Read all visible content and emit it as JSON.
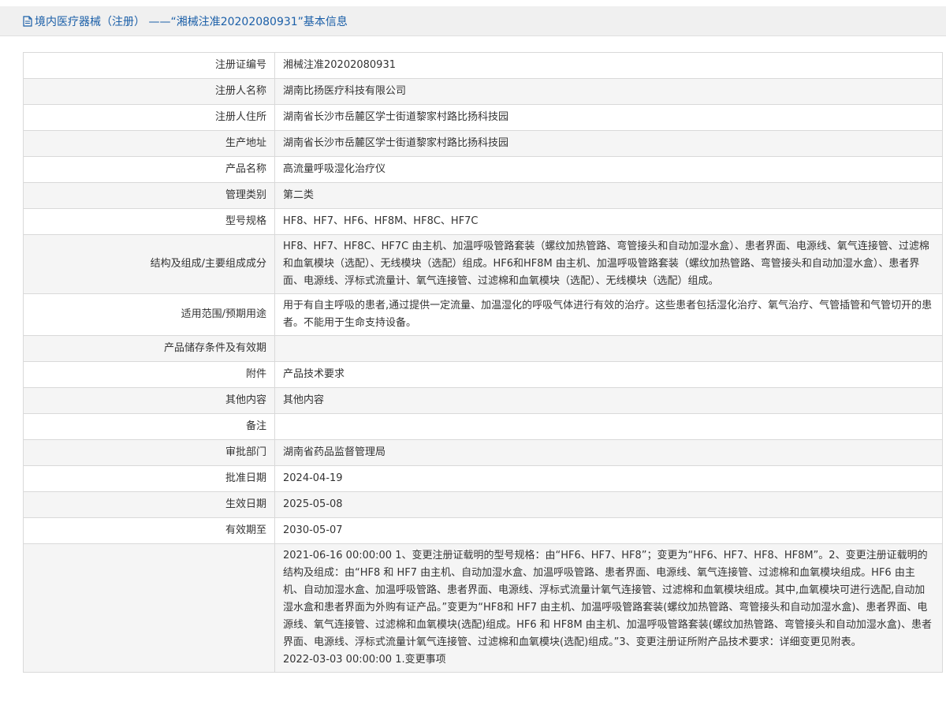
{
  "header": {
    "title": "境内医疗器械（注册） ——“湘械注准20202080931”基本信息"
  },
  "rows": [
    {
      "label": "注册证编号",
      "value": "湘械注准20202080931"
    },
    {
      "label": "注册人名称",
      "value": "湖南比扬医疗科技有限公司"
    },
    {
      "label": "注册人住所",
      "value": "湖南省长沙市岳麓区学士街道黎家村路比扬科技园"
    },
    {
      "label": "生产地址",
      "value": "湖南省长沙市岳麓区学士街道黎家村路比扬科技园"
    },
    {
      "label": "产品名称",
      "value": "高流量呼吸湿化治疗仪"
    },
    {
      "label": "管理类别",
      "value": "第二类"
    },
    {
      "label": "型号规格",
      "value": "HF8、HF7、HF6、HF8M、HF8C、HF7C"
    },
    {
      "label": "结构及组成/主要组成成分",
      "value": "HF8、HF7、HF8C、HF7C 由主机、加温呼吸管路套装（螺纹加热管路、弯管接头和自动加湿水盒）、患者界面、电源线、氧气连接管、过滤棉和血氧模块（选配）、无线模块（选配）组成。HF6和HF8M 由主机、加温呼吸管路套装（螺纹加热管路、弯管接头和自动加湿水盒）、患者界面、电源线、浮标式流量计、氧气连接管、过滤棉和血氧模块（选配）、无线模块（选配）组成。"
    },
    {
      "label": "适用范围/预期用途",
      "value": "用于有自主呼吸的患者,通过提供一定流量、加温湿化的呼吸气体进行有效的治疗。这些患者包括湿化治疗、氧气治疗、气管插管和气管切开的患者。不能用于生命支持设备。"
    },
    {
      "label": "产品储存条件及有效期",
      "value": ""
    },
    {
      "label": "附件",
      "value": "产品技术要求"
    },
    {
      "label": "其他内容",
      "value": "其他内容"
    },
    {
      "label": "备注",
      "value": ""
    },
    {
      "label": "审批部门",
      "value": "湖南省药品监督管理局"
    },
    {
      "label": "批准日期",
      "value": "2024-04-19"
    },
    {
      "label": "生效日期",
      "value": "2025-05-08"
    },
    {
      "label": "有效期至",
      "value": "2030-05-07"
    }
  ],
  "changes": {
    "label": "",
    "entries": [
      "2021-06-16 00:00:00 1、变更注册证载明的型号规格：由“HF6、HF7、HF8”；变更为“HF6、HF7、HF8、HF8M”。2、变更注册证载明的结构及组成：由“HF8 和 HF7 由主机、自动加湿水盒、加温呼吸管路、患者界面、电源线、氧气连接管、过滤棉和血氧模块组成。HF6 由主机、自动加湿水盒、加温呼吸管路、患者界面、电源线、浮标式流量计氧气连接管、过滤棉和血氧模块组成。其中,血氧模块可进行选配,自动加湿水盒和患者界面为外购有证产品。”变更为“HF8和 HF7 由主机、加温呼吸管路套装(螺纹加热管路、弯管接头和自动加湿水盒)、患者界面、电源线、氧气连接管、过滤棉和血氧模块(选配)组成。HF6 和 HF8M 由主机、加温呼吸管路套装(螺纹加热管路、弯管接头和自动加湿水盒)、患者界面、电源线、浮标式流量计氧气连接管、过滤棉和血氧模块(选配)组成。”3、变更注册证所附产品技术要求：详细变更见附表。",
      "2022-03-03 00:00:00 1.变更事项"
    ]
  },
  "colors": {
    "title_blue": "#1b5fa8",
    "header_bg": "#f0f0f0",
    "alt_row_bg": "#f5f5f5",
    "border": "#d9d9d9"
  }
}
